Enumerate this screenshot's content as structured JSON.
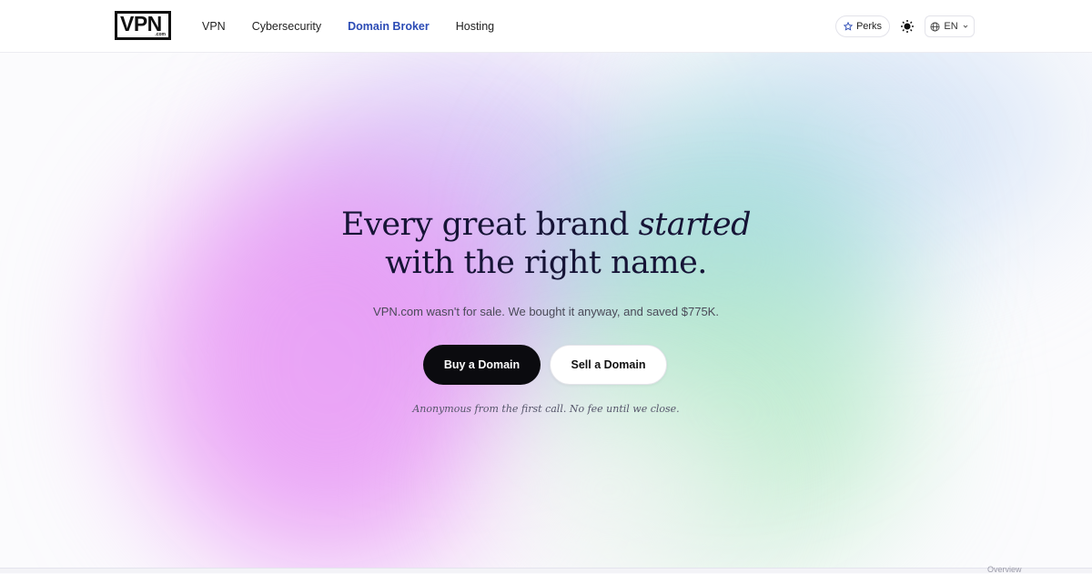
{
  "header": {
    "logo_text": "VPN",
    "logo_sub": ".com",
    "nav": [
      {
        "label": "VPN"
      },
      {
        "label": "Cybersecurity"
      },
      {
        "label": "Domain Broker"
      },
      {
        "label": "Hosting"
      }
    ],
    "active_nav": "Domain Broker",
    "perks_label": "Perks",
    "language": "EN"
  },
  "hero": {
    "headline_part1": "Every great brand ",
    "headline_italic": "started",
    "headline_line2": "with the right name.",
    "subtext": "VPN.com wasn't for sale. We bought it anyway, and saved $775K.",
    "buy_label": "Buy a Domain",
    "sell_label": "Sell a Domain",
    "footnote": "Anonymous from the first call. No fee until we close."
  },
  "bottom": {
    "overview_label": "Overview"
  },
  "colors": {
    "accent_nav": "#2b4bb5",
    "headline": "#161436",
    "primary_button": "#0b0b0f"
  }
}
